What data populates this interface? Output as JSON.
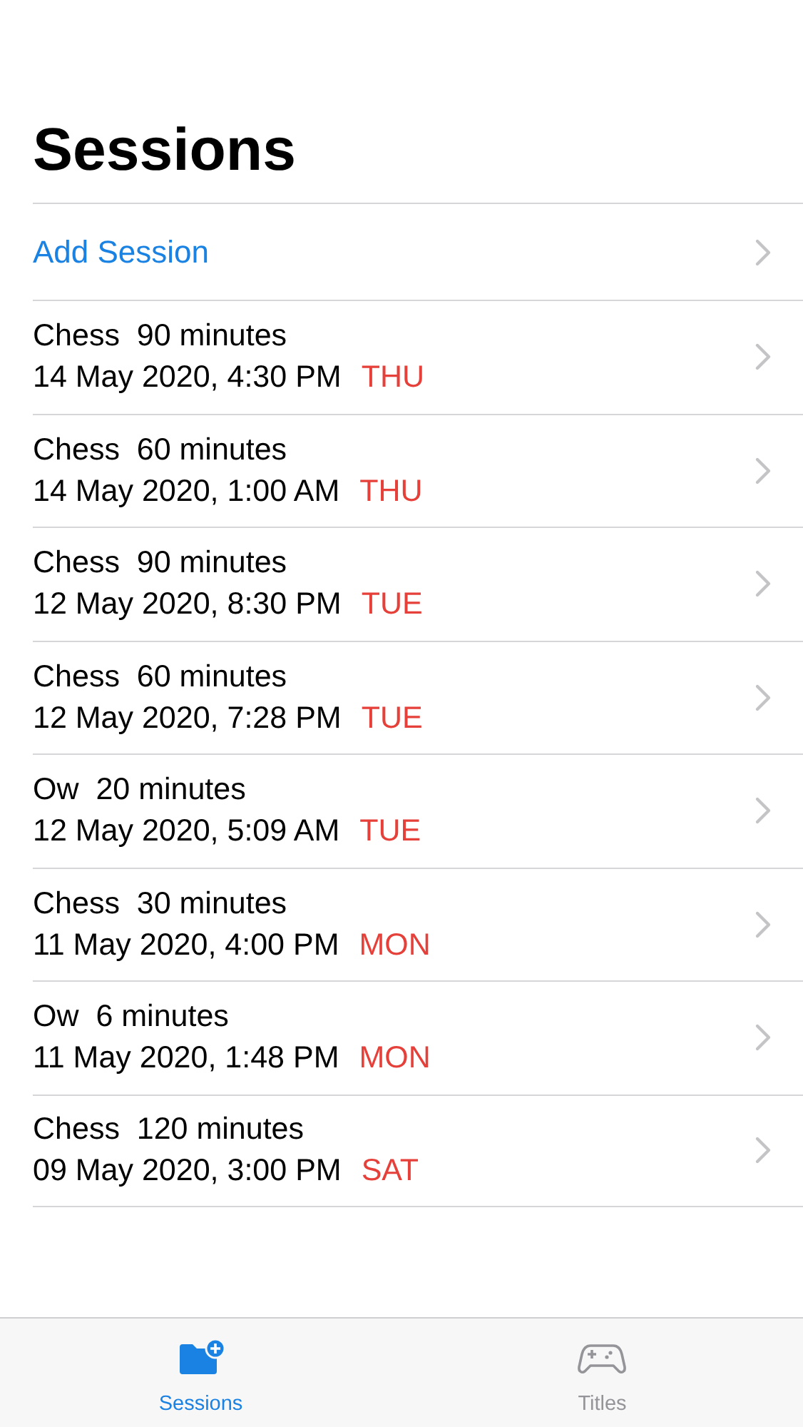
{
  "title": "Sessions",
  "add_row": {
    "label": "Add Session"
  },
  "sessions": [
    {
      "summary": "Chess  90 minutes",
      "date": "14 May 2020, 4:30 PM",
      "weekday": "THU"
    },
    {
      "summary": "Chess  60 minutes",
      "date": "14 May 2020, 1:00 AM",
      "weekday": "THU"
    },
    {
      "summary": "Chess  90 minutes",
      "date": "12 May 2020, 8:30 PM",
      "weekday": "TUE"
    },
    {
      "summary": "Chess  60 minutes",
      "date": "12 May 2020, 7:28 PM",
      "weekday": "TUE"
    },
    {
      "summary": "Ow  20 minutes",
      "date": "12 May 2020, 5:09 AM",
      "weekday": "TUE"
    },
    {
      "summary": "Chess  30 minutes",
      "date": "11 May 2020, 4:00 PM",
      "weekday": "MON"
    },
    {
      "summary": "Ow  6 minutes",
      "date": "11 May 2020, 1:48 PM",
      "weekday": "MON"
    },
    {
      "summary": "Chess  120 minutes",
      "date": "09 May 2020, 3:00 PM",
      "weekday": "SAT"
    }
  ],
  "tabs": [
    {
      "label": "Sessions",
      "kind": "folder",
      "selected": true
    },
    {
      "label": "Titles",
      "kind": "gamepad",
      "selected": false
    }
  ]
}
